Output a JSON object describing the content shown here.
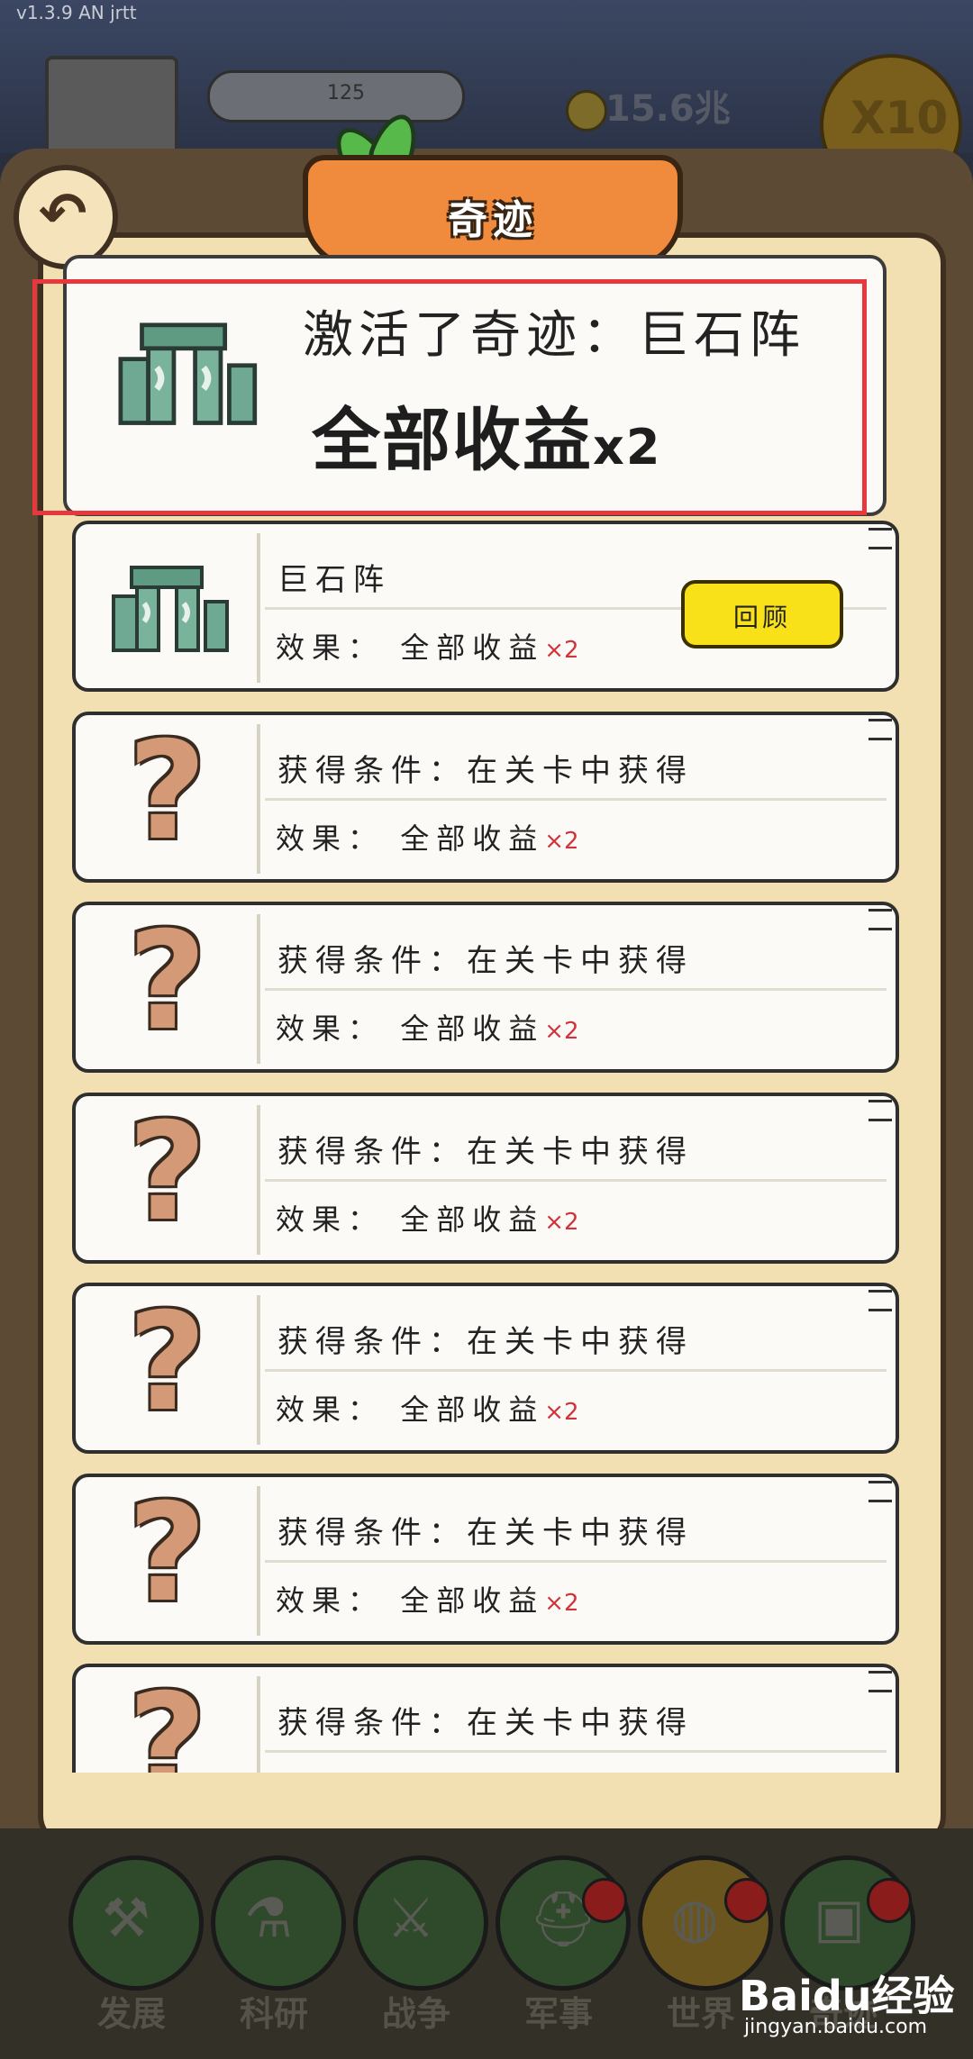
{
  "version": "v1.3.9 AN jrtt",
  "background": {
    "counter": "125",
    "money": "15.6兆",
    "speed_button": "X10"
  },
  "panel": {
    "title": "奇迹",
    "back_icon": "undo-arrow-icon"
  },
  "notification": {
    "title": "激活了奇迹：巨石阵",
    "effect_text": "全部收益",
    "effect_mult": "x2",
    "icon": "stonehenge-icon"
  },
  "wonders": [
    {
      "name": "巨石阵",
      "effect_label": "效果：",
      "effect_text": "全部收益",
      "mult": "×2",
      "icon": "stonehenge-icon",
      "unlocked": true,
      "button": "回顾"
    },
    {
      "name": "获得条件：在关卡中获得",
      "effect_label": "效果：",
      "effect_text": "全部收益",
      "mult": "×2",
      "icon": "question-mark-icon",
      "unlocked": false
    },
    {
      "name": "获得条件：在关卡中获得",
      "effect_label": "效果：",
      "effect_text": "全部收益",
      "mult": "×2",
      "icon": "question-mark-icon",
      "unlocked": false
    },
    {
      "name": "获得条件：在关卡中获得",
      "effect_label": "效果：",
      "effect_text": "全部收益",
      "mult": "×2",
      "icon": "question-mark-icon",
      "unlocked": false
    },
    {
      "name": "获得条件：在关卡中获得",
      "effect_label": "效果：",
      "effect_text": "全部收益",
      "mult": "×2",
      "icon": "question-mark-icon",
      "unlocked": false
    },
    {
      "name": "获得条件：在关卡中获得",
      "effect_label": "效果：",
      "effect_text": "全部收益",
      "mult": "×2",
      "icon": "question-mark-icon",
      "unlocked": false
    },
    {
      "name": "获得条件：在关卡中获得",
      "icon": "question-mark-icon",
      "unlocked": false
    }
  ],
  "bottom_nav": [
    {
      "label": "发展",
      "icon": "hammer-icon",
      "badge": false
    },
    {
      "label": "科研",
      "icon": "flask-icon",
      "badge": false
    },
    {
      "label": "战争",
      "icon": "swords-icon",
      "badge": false
    },
    {
      "label": "军事",
      "icon": "helmet-icon",
      "badge": true
    },
    {
      "label": "世界",
      "icon": "globe-icon",
      "badge": true
    },
    {
      "label": "奇迹",
      "icon": "monument-icon",
      "badge": true
    }
  ],
  "watermark": {
    "brand": "Baidu经验",
    "url": "jingyan.baidu.com"
  }
}
